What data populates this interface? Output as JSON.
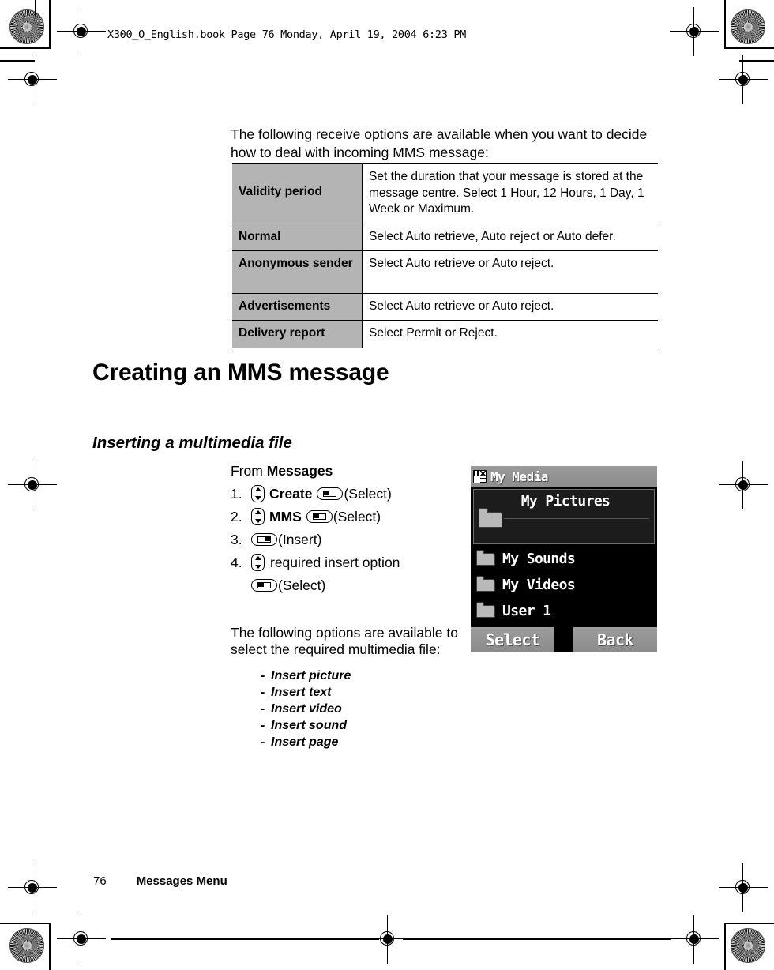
{
  "book_header": "X300_O_English.book  Page 76  Monday, April 19, 2004  6:23 PM",
  "intro_paragraph": "The following receive options are available when you want to decide how to deal with incoming MMS message:",
  "options_table": {
    "rows": [
      {
        "label": "Validity period",
        "description": "Set the duration that your message is stored at the message centre. Select 1 Hour, 12 Hours, 1 Day, 1 Week or Maximum."
      },
      {
        "label": "Normal",
        "description": "Select Auto retrieve, Auto reject or Auto defer."
      },
      {
        "label": "Anonymous sender",
        "description": "Select Auto retrieve or Auto reject."
      },
      {
        "label": "Advertisements",
        "description": "Select Auto retrieve or Auto reject."
      },
      {
        "label": "Delivery report",
        "description": "Select Permit or Reject."
      }
    ]
  },
  "chapter_heading": "Creating an MMS message",
  "section_heading": "Inserting a multimedia file",
  "procedure": {
    "from_prefix": "From ",
    "from_target": "Messages",
    "steps": [
      {
        "num": "1.",
        "text": "Create",
        "action": "(Select)"
      },
      {
        "num": "2.",
        "text": "MMS",
        "action": "(Select)"
      },
      {
        "num": "3.",
        "text": "",
        "action": "(Insert)"
      },
      {
        "num": "4.",
        "text": "required insert option",
        "action": "(Select)"
      }
    ]
  },
  "after_paragraph": "The following options are available to select the required multimedia file:",
  "insert_options": [
    "Insert picture",
    "Insert text",
    "Insert video",
    "Insert sound",
    "Insert page"
  ],
  "phone_screen": {
    "title": "My Media",
    "selected_item": "My Pictures",
    "items": [
      "My Sounds",
      "My Videos",
      "User 1"
    ],
    "softkey_left": "Select",
    "softkey_right": "Back"
  },
  "footer": {
    "page_number": "76",
    "section_name": "Messages Menu"
  },
  "colors": {
    "table_label_bg": "#b4b4b4",
    "phone_bg": "#000000",
    "phone_chrome": "#949494"
  }
}
